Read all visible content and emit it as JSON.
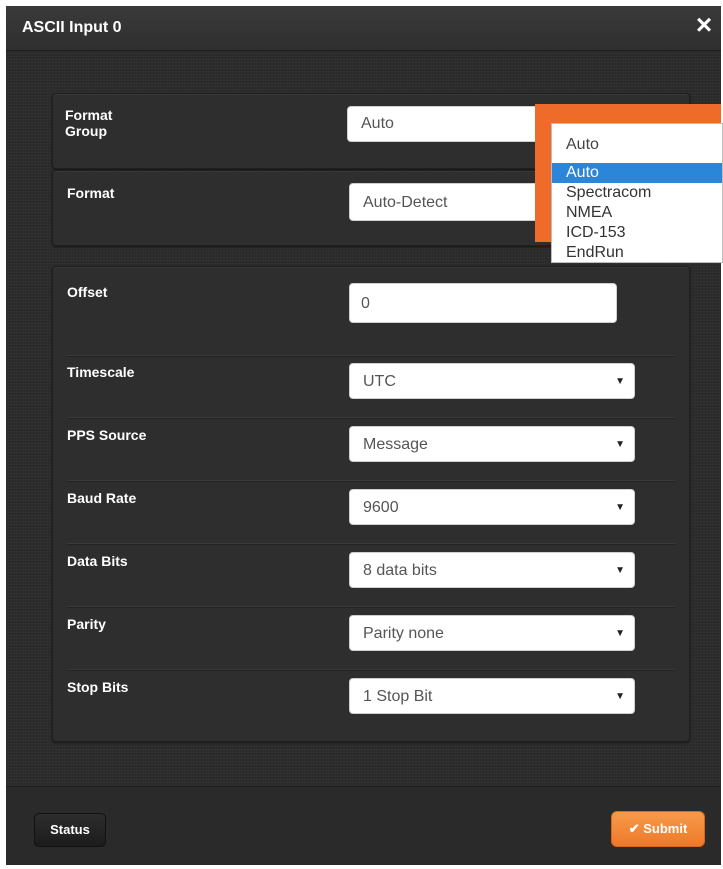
{
  "dialog": {
    "title": "ASCII Input 0",
    "close_icon": "×"
  },
  "format_group": {
    "label": "Format Group",
    "value": "Auto",
    "caret": "▼"
  },
  "format": {
    "label": "Format",
    "value": "Auto-Detect"
  },
  "dropdown": {
    "current": "Auto",
    "options": [
      "Auto",
      "Spectracom",
      "NMEA",
      "ICD-153",
      "EndRun"
    ],
    "selected": "Auto"
  },
  "settings": {
    "offset": {
      "label": "Offset",
      "value": "0"
    },
    "timescale": {
      "label": "Timescale",
      "value": "UTC"
    },
    "pps_source": {
      "label": "PPS Source",
      "value": "Message"
    },
    "baud_rate": {
      "label": "Baud Rate",
      "value": "9600"
    },
    "data_bits": {
      "label": "Data Bits",
      "value": "8 data bits"
    },
    "parity": {
      "label": "Parity",
      "value": "Parity none"
    },
    "stop_bits": {
      "label": "Stop Bits",
      "value": "1 Stop Bit"
    },
    "caret": "▼"
  },
  "footer": {
    "status_label": "Status",
    "submit_label": "Submit",
    "submit_icon": "✔"
  },
  "colors": {
    "accent": "#ef6b2a",
    "selection": "#2b85d8",
    "background": "#2c2c2c"
  }
}
